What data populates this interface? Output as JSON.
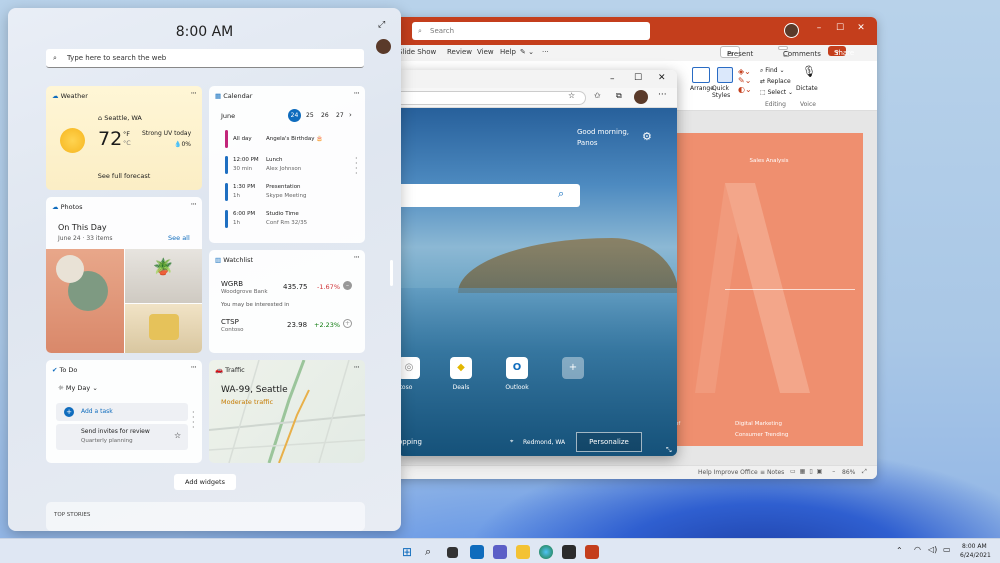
{
  "ppt": {
    "search_placeholder": "Search",
    "menu": [
      "Slide Show",
      "Review",
      "View",
      "Help"
    ],
    "present": "Present",
    "comments": "Comments",
    "share": "Share",
    "ribbon": {
      "arrange": "Arrange",
      "quick_styles": "Quick Styles",
      "find": "Find",
      "replace": "Replace",
      "select": "Select",
      "dictate": "Dictate",
      "group_drawing": "rawing",
      "group_editing": "Editing",
      "group_voice": "Voice"
    },
    "slide": {
      "title": "Sales Analysis",
      "left_text": "of",
      "item1": "Digital Marketing",
      "item2": "Consumer Trending"
    },
    "status": {
      "help": "Help Improve Office",
      "notes": "Notes",
      "zoom": "86%"
    }
  },
  "edge": {
    "greeting": "Good morning,",
    "name": "Panos",
    "tiles": [
      {
        "label": "toso",
        "icon": "contoso-icon"
      },
      {
        "label": "Deals",
        "icon": "deals-icon"
      },
      {
        "label": "Outlook",
        "icon": "outlook-icon"
      }
    ],
    "bottom_left": "opping",
    "location": "Redmond, WA",
    "personalize": "Personalize"
  },
  "widgets": {
    "time": "8:00 AM",
    "search_placeholder": "Type here to search the web",
    "weather": {
      "title": "Weather",
      "location": "Seattle, WA",
      "temp": "72",
      "unit_f": "°F",
      "unit_c": "°C",
      "uv": "Strong UV today",
      "precip": "0%",
      "link": "See full forecast"
    },
    "calendar": {
      "title": "Calendar",
      "month": "June",
      "days": [
        "24",
        "25",
        "26",
        "27"
      ],
      "events": [
        {
          "time": "All day",
          "duration": "",
          "title": "Angela's Birthday 🎂",
          "subtitle": "",
          "color": "#c2267a"
        },
        {
          "time": "12:00 PM",
          "duration": "30 min",
          "title": "Lunch",
          "subtitle": "Alex Johnson",
          "color": "#1f6fc1"
        },
        {
          "time": "1:30 PM",
          "duration": "1h",
          "title": "Presentation",
          "subtitle": "Skype Meeting",
          "color": "#1f6fc1"
        },
        {
          "time": "6:00 PM",
          "duration": "1h",
          "title": "Studio Time",
          "subtitle": "Conf Rm 32/35",
          "color": "#1f6fc1"
        }
      ]
    },
    "photos": {
      "title": "Photos",
      "heading": "On This Day",
      "sub": "June 24 · 33 items",
      "link": "See all"
    },
    "watchlist": {
      "title": "Watchlist",
      "stocks": [
        {
          "symbol": "WGRB",
          "company": "Woodgrove Bank",
          "price": "435.75",
          "change": "-1.67%",
          "color": "#d13438"
        },
        {
          "symbol": "CTSP",
          "company": "Contoso",
          "price": "23.98",
          "change": "+2.23%",
          "color": "#107c10"
        }
      ],
      "interest": "You may be interested in"
    },
    "todo": {
      "title": "To Do",
      "list": "My Day",
      "add": "Add a task",
      "task": "Send invites for review",
      "task_sub": "Quarterly planning"
    },
    "traffic": {
      "title": "Traffic",
      "road": "WA-99, Seattle",
      "status": "Moderate traffic"
    },
    "add_widgets": "Add widgets",
    "top_stories": "TOP STORIES"
  },
  "taskbar": {
    "time": "8:00 AM",
    "date": "6/24/2021",
    "apps": [
      "windows-icon",
      "search-icon",
      "taskview-icon",
      "widgets-icon",
      "teams-icon",
      "explorer-icon",
      "edge-icon",
      "store-icon",
      "powerpoint-icon"
    ]
  },
  "colors": {
    "ppt_accent": "#c43e1c",
    "slide": "#ef8f6f",
    "edge_accent": "#0f6cbd"
  }
}
